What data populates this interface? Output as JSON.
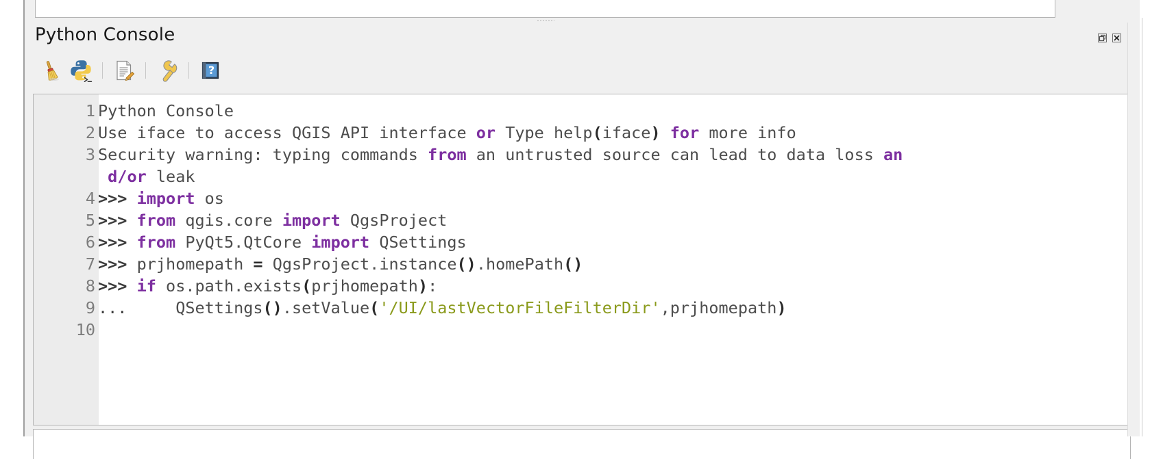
{
  "panel": {
    "title": "Python Console",
    "titlebar_buttons": [
      {
        "name": "float-dock-button",
        "label": "Float"
      },
      {
        "name": "close-dock-button",
        "label": "Close"
      }
    ]
  },
  "toolbar": {
    "items": [
      {
        "name": "clear-console-button",
        "icon": "broom-icon",
        "label": "Clear Console"
      },
      {
        "name": "run-script-button",
        "icon": "python-icon",
        "label": "Run Script"
      },
      {
        "name": "show-editor-button",
        "icon": "document-pencil-icon",
        "label": "Show Editor"
      },
      {
        "name": "options-button",
        "icon": "wrench-icon",
        "label": "Options"
      },
      {
        "name": "help-button",
        "icon": "help-book-icon",
        "label": "Help"
      }
    ],
    "separator_positions": [
      2,
      3
    ]
  },
  "console": {
    "line_numbers": [
      "1",
      "2",
      "3",
      "",
      "4",
      "5",
      "6",
      "7",
      "8",
      "9",
      "10"
    ],
    "lines": [
      {
        "number": "1",
        "tokens": [
          {
            "t": "Python Console",
            "c": "plain"
          }
        ]
      },
      {
        "number": "2",
        "tokens": [
          {
            "t": "Use iface to access QGIS API interface ",
            "c": "plain"
          },
          {
            "t": "or",
            "c": "kw"
          },
          {
            "t": " Type help",
            "c": "plain"
          },
          {
            "t": "(",
            "c": "paren"
          },
          {
            "t": "iface",
            "c": "plain"
          },
          {
            "t": ")",
            "c": "paren"
          },
          {
            "t": " ",
            "c": "plain"
          },
          {
            "t": "for",
            "c": "kw"
          },
          {
            "t": " more info",
            "c": "plain"
          }
        ]
      },
      {
        "number": "3",
        "tokens": [
          {
            "t": "Security warning: typing commands ",
            "c": "plain"
          },
          {
            "t": "from",
            "c": "kw"
          },
          {
            "t": " an untrusted source can lead to data loss ",
            "c": "plain"
          },
          {
            "t": "an",
            "c": "kw"
          }
        ]
      },
      {
        "number": "",
        "continuation": true,
        "tokens": [
          {
            "t": " ",
            "c": "plain"
          },
          {
            "t": "d/or",
            "c": "kw"
          },
          {
            "t": " leak",
            "c": "plain"
          }
        ]
      },
      {
        "number": "4",
        "tokens": [
          {
            "t": ">>>",
            "c": "prompt"
          },
          {
            "t": " ",
            "c": "plain"
          },
          {
            "t": "import",
            "c": "kw"
          },
          {
            "t": " os",
            "c": "plain"
          }
        ]
      },
      {
        "number": "5",
        "tokens": [
          {
            "t": ">>>",
            "c": "prompt"
          },
          {
            "t": " ",
            "c": "plain"
          },
          {
            "t": "from",
            "c": "kw"
          },
          {
            "t": " qgis.core ",
            "c": "plain"
          },
          {
            "t": "import",
            "c": "kw"
          },
          {
            "t": " QgsProject",
            "c": "plain"
          }
        ]
      },
      {
        "number": "6",
        "tokens": [
          {
            "t": ">>>",
            "c": "prompt"
          },
          {
            "t": " ",
            "c": "plain"
          },
          {
            "t": "from",
            "c": "kw"
          },
          {
            "t": " PyQt5.QtCore ",
            "c": "plain"
          },
          {
            "t": "import",
            "c": "kw"
          },
          {
            "t": " QSettings",
            "c": "plain"
          }
        ]
      },
      {
        "number": "7",
        "tokens": [
          {
            "t": ">>>",
            "c": "prompt"
          },
          {
            "t": " prjhomepath ",
            "c": "plain"
          },
          {
            "t": "=",
            "c": "op"
          },
          {
            "t": " QgsProject.instance",
            "c": "plain"
          },
          {
            "t": "()",
            "c": "paren"
          },
          {
            "t": ".homePath",
            "c": "plain"
          },
          {
            "t": "()",
            "c": "paren"
          }
        ]
      },
      {
        "number": "8",
        "tokens": [
          {
            "t": ">>>",
            "c": "prompt"
          },
          {
            "t": " ",
            "c": "plain"
          },
          {
            "t": "if",
            "c": "kw"
          },
          {
            "t": " os.path.exists",
            "c": "plain"
          },
          {
            "t": "(",
            "c": "paren"
          },
          {
            "t": "prjhomepath",
            "c": "plain"
          },
          {
            "t": ")",
            "c": "paren"
          },
          {
            "t": ":",
            "c": "plain"
          }
        ]
      },
      {
        "number": "9",
        "tokens": [
          {
            "t": "...",
            "c": "dots-prompt"
          },
          {
            "t": "     QSettings",
            "c": "plain"
          },
          {
            "t": "()",
            "c": "paren"
          },
          {
            "t": ".setValue",
            "c": "plain"
          },
          {
            "t": "(",
            "c": "paren"
          },
          {
            "t": "'/UI/lastVectorFileFilterDir'",
            "c": "str"
          },
          {
            "t": ",",
            "c": "plain"
          },
          {
            "t": "prjhomepath",
            "c": "plain"
          },
          {
            "t": ")",
            "c": "paren"
          }
        ]
      },
      {
        "number": "10",
        "tokens": []
      }
    ]
  },
  "colors": {
    "keyword": "#7d2fa0",
    "string": "#8a9a1b",
    "text": "#4d4d4d",
    "gutter_bg": "#ececec",
    "line_number": "#7d7d7d",
    "panel_bg": "#f0f0f0",
    "editor_bg": "#ffffff",
    "border": "#b4b4b4"
  },
  "input": {
    "prompt": ">>>",
    "value": "",
    "placeholder": ""
  }
}
